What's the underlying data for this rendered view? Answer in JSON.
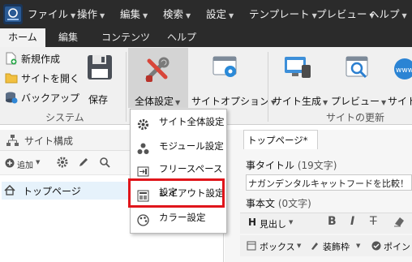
{
  "menubar": {
    "items": [
      "ファイル",
      "操作",
      "編集",
      "検索",
      "設定",
      "テンプレート",
      "プレビュー",
      "ヘルプ"
    ]
  },
  "ribbon_tabs": [
    "ホーム",
    "編集",
    "コンテンツ",
    "ヘルプ"
  ],
  "ribbon": {
    "new_label": "新規作成",
    "open_label": "サイトを開く",
    "backup_label": "バックアップ",
    "save_label": "保存",
    "system_group": "システム",
    "global_settings_label": "全体設定",
    "site_options_label": "サイトオプション",
    "site_generate_label": "サイト生成",
    "preview_label": "プレビュー",
    "site_transfer_label": "サイト",
    "update_group": "サイトの更新"
  },
  "left_panel": {
    "title": "サイト構成",
    "add_label": "追加",
    "tree_item": "トップページ"
  },
  "right_panel": {
    "doc_tab": "トップページ*",
    "title_label": "事タイトル",
    "title_count": "(19文字)",
    "title_value": "ナガンデンタルキャットフードを比較！",
    "body_label": "事本文",
    "body_count": "(0文字)",
    "heading_label": "見出し",
    "box_label": "ボックス",
    "decor_label": "装飾枠",
    "point_label": "ポイント"
  },
  "dropdown": {
    "items": [
      "サイト全体設定",
      "モジュール設定",
      "フリースペース設定",
      "レイアウト設定",
      "カラー設定"
    ]
  },
  "colors": {
    "menubar_bg": "#2b2b2b",
    "highlight": "#e0151b",
    "tree_selected": "#e6f2fb"
  }
}
